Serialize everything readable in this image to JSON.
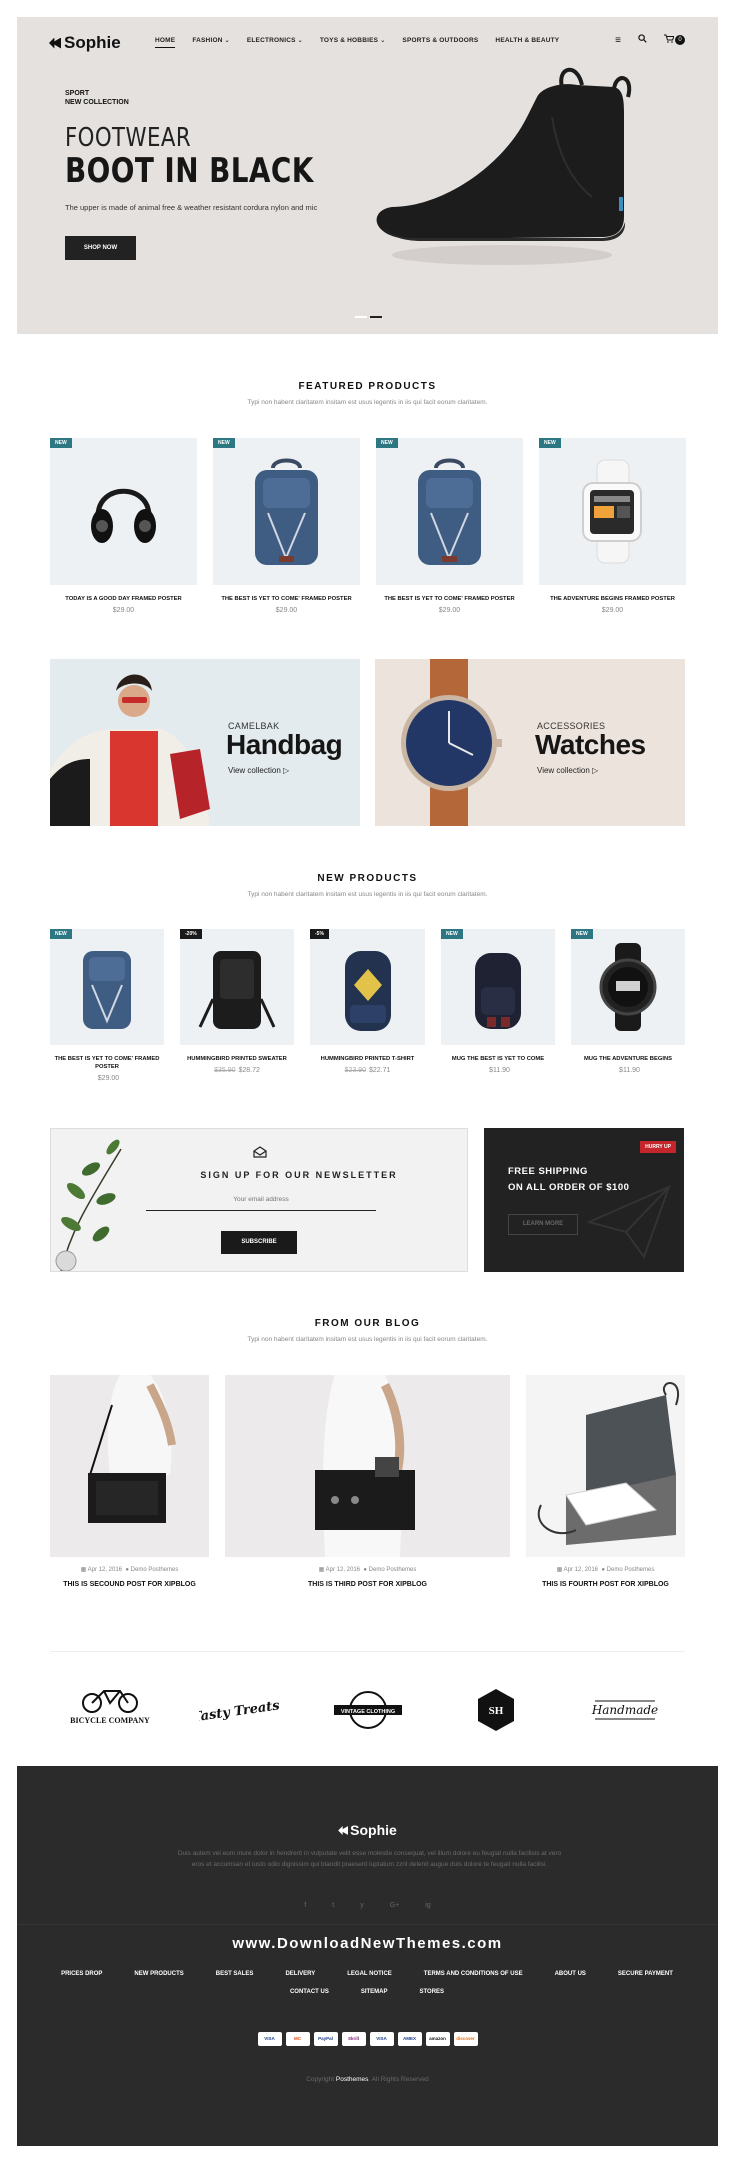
{
  "header": {
    "logo": "Sophie",
    "menu": [
      "HOME",
      "FASHION",
      "ELECTRONICS",
      "TOYS & HOBBIES",
      "SPORTS & OUTDOORS",
      "HEALTH & BEAUTY"
    ],
    "cart_count": "0"
  },
  "hero": {
    "tag_line1": "SPORT",
    "tag_line2": "NEW COLLECTION",
    "subtitle": "FOOTWEAR",
    "title": "BOOT IN BLACK",
    "text": "The upper is made of animal free & weather resistant cordura nylon and mic",
    "button": "SHOP NOW"
  },
  "featured": {
    "title": "FEATURED PRODUCTS",
    "subtitle": "Typi non habent claritatem insitam est usus legentis in iis qui facit eorum claritatem.",
    "items": [
      {
        "badge": "NEW",
        "name": "TODAY IS A GOOD DAY FRAMED POSTER",
        "price": "$29.00",
        "icon": "headphones"
      },
      {
        "badge": "NEW",
        "name": "THE BEST IS YET TO COME' FRAMED POSTER",
        "price": "$29.00",
        "icon": "backpack"
      },
      {
        "badge": "NEW",
        "name": "THE BEST IS YET TO COME' FRAMED POSTER",
        "price": "$29.00",
        "icon": "backpack"
      },
      {
        "badge": "NEW",
        "name": "THE ADVENTURE BEGINS FRAMED POSTER",
        "price": "$29.00",
        "icon": "smartwatch"
      }
    ]
  },
  "banners": [
    {
      "small": "CAMELBAK",
      "big": "Handbag",
      "link": "View collection"
    },
    {
      "small": "ACCESSORIES",
      "big": "Watches",
      "link": "View collection"
    }
  ],
  "new_products": {
    "title": "NEW PRODUCTS",
    "subtitle": "Typi non habent claritatem insitam est usus legentis in iis qui facit eorum claritatem.",
    "items": [
      {
        "badge": "NEW",
        "name": "THE BEST IS YET TO COME' FRAMED POSTER",
        "old_price": "",
        "price": "$29.00"
      },
      {
        "badge": "-20%",
        "name": "HUMMINGBIRD PRINTED SWEATER",
        "old_price": "$35.90",
        "price": "$28.72"
      },
      {
        "badge": "-5%",
        "name": "HUMMINGBIRD PRINTED T-SHIRT",
        "old_price": "$23.90",
        "price": "$22.71"
      },
      {
        "badge": "NEW",
        "name": "MUG THE BEST IS YET TO COME",
        "old_price": "",
        "price": "$11.90"
      },
      {
        "badge": "NEW",
        "name": "MUG THE ADVENTURE BEGINS",
        "old_price": "",
        "price": "$11.90"
      }
    ]
  },
  "newsletter": {
    "title": "SIGN UP FOR OUR NEWSLETTER",
    "placeholder": "Your email address",
    "button": "SUBSCRIBE"
  },
  "shipping": {
    "badge": "HURRY UP",
    "line1": "FREE SHIPPING",
    "line2": "ON ALL ORDER OF $100",
    "button": "LEARN MORE"
  },
  "blog": {
    "title": "FROM OUR BLOG",
    "subtitle": "Typi non habent claritatem insitam est usus legentis in iis qui facit eorum claritatem.",
    "posts": [
      {
        "date": "Apr 12, 2016",
        "author": "Demo Posthemes",
        "title": "THIS IS SECOUND POST FOR XIPBLOG"
      },
      {
        "date": "Apr 12, 2016",
        "author": "Demo Posthemes",
        "title": "THIS IS THIRD POST FOR XIPBLOG"
      },
      {
        "date": "Apr 12, 2016",
        "author": "Demo Posthemes",
        "title": "THIS IS FOURTH POST FOR XIPBLOG"
      }
    ]
  },
  "brands": [
    "BICYCLE COMPANY",
    "Tasty Treats!",
    "VINTAGE CLOTHING",
    "SH",
    "Handmade"
  ],
  "footer": {
    "logo": "Sophie",
    "text": "Duis autem vel eum iriure dolor in hendrerit in vulputate velit esse molestie consequat, vel illum dolore eu feugiat nulla facilisis at vero eros et accumsan et iusto odio dignissim qui blandit praesent luptatum zzril delenit augue duis dolore te feugait nulla facilisi.",
    "social": [
      "f",
      "t",
      "y",
      "G+",
      "ig"
    ],
    "watermark": "www.DownloadNewThemes.com",
    "links": [
      "PRICES DROP",
      "NEW PRODUCTS",
      "BEST SALES",
      "DELIVERY",
      "LEGAL NOTICE",
      "TERMS AND CONDITIONS OF USE",
      "ABOUT US",
      "SECURE PAYMENT",
      "CONTACT US",
      "SITEMAP",
      "STORES"
    ],
    "payments": [
      "VISA",
      "MC",
      "PayPal",
      "Skrill",
      "VISA",
      "AMEX",
      "amazon",
      "discover"
    ],
    "copyright_prefix": "Copyright",
    "copyright_brand": "Posthemes",
    "copyright_suffix": ". All Rights Reserved"
  }
}
